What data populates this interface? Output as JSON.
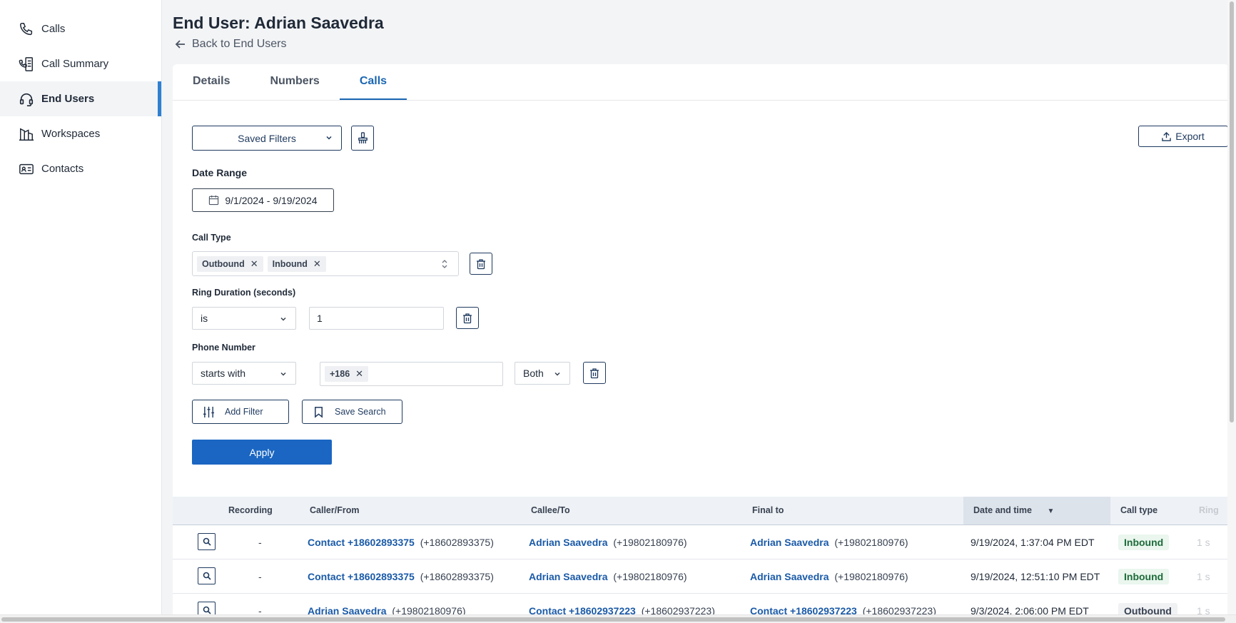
{
  "sidebar": {
    "items": [
      {
        "label": "Calls",
        "icon": "phone-icon"
      },
      {
        "label": "Call Summary",
        "icon": "call-summary-icon"
      },
      {
        "label": "End Users",
        "icon": "headset-icon",
        "active": true
      },
      {
        "label": "Workspaces",
        "icon": "building-icon"
      },
      {
        "label": "Contacts",
        "icon": "contact-card-icon"
      }
    ]
  },
  "header": {
    "title": "End User: Adrian Saavedra",
    "back_label": "Back to End Users"
  },
  "tabs": [
    {
      "label": "Details"
    },
    {
      "label": "Numbers"
    },
    {
      "label": "Calls",
      "active": true
    }
  ],
  "filters": {
    "saved_filters_label": "Saved Filters",
    "export_label": "Export",
    "date_range_label": "Date Range",
    "date_range_value": "9/1/2024 - 9/19/2024",
    "call_type_label": "Call Type",
    "call_type_chips": [
      "Outbound",
      "Inbound"
    ],
    "ring_duration_label": "Ring Duration (seconds)",
    "ring_duration_operator": "is",
    "ring_duration_value": "1",
    "phone_number_label": "Phone Number",
    "phone_number_operator": "starts with",
    "phone_number_chip": "+186",
    "phone_number_direction": "Both",
    "add_filter_label": "Add Filter",
    "save_search_label": "Save Search",
    "apply_label": "Apply"
  },
  "table": {
    "columns": {
      "recording": "Recording",
      "caller": "Caller/From",
      "callee": "Callee/To",
      "final_to": "Final to",
      "datetime": "Date and time",
      "call_type": "Call type",
      "ring": "Ring"
    },
    "sort_indicator": "▼",
    "rows": [
      {
        "recording": "-",
        "caller_name": "Contact +18602893375",
        "caller_num": "(+18602893375)",
        "callee_name": "Adrian Saavedra",
        "callee_num": "(+19802180976)",
        "final_name": "Adrian Saavedra",
        "final_num": "(+19802180976)",
        "datetime": "9/19/2024, 1:37:04 PM EDT",
        "call_type": "Inbound",
        "ring": "1 s"
      },
      {
        "recording": "-",
        "caller_name": "Contact +18602893375",
        "caller_num": "(+18602893375)",
        "callee_name": "Adrian Saavedra",
        "callee_num": "(+19802180976)",
        "final_name": "Adrian Saavedra",
        "final_num": "(+19802180976)",
        "datetime": "9/19/2024, 12:51:10 PM EDT",
        "call_type": "Inbound",
        "ring": "1 s"
      },
      {
        "recording": "-",
        "caller_name": "Adrian Saavedra",
        "caller_num": "(+19802180976)",
        "callee_name": "Contact +18602937223",
        "callee_num": "(+18602937223)",
        "final_name": "Contact +18602937223",
        "final_num": "(+18602937223)",
        "datetime": "9/3/2024, 2:06:00 PM EDT",
        "call_type": "Outbound",
        "ring": "1 s"
      }
    ]
  },
  "colors": {
    "accent": "#1a66c2",
    "link": "#1a5aa8",
    "sidebar_active_bar": "#2f80d1",
    "inbound_bg": "#eaf6ee",
    "inbound_text": "#1d6b3a"
  }
}
